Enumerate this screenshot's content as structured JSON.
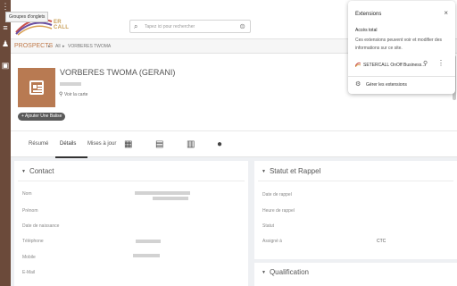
{
  "tooltip": "Groupes d'onglets",
  "header": {
    "logo_text": [
      "ER",
      "CALL"
    ],
    "search_placeholder": "Tapez ici pour rechercher"
  },
  "breadcrumb": {
    "main": "PROSPECTS",
    "items": [
      "All",
      "VORBERES TWOMA"
    ]
  },
  "profile": {
    "name": "VORBERES TWOMA (GERANI)",
    "location_link": "Voir la carte",
    "add_tag_label": "+ Ajouter Une Balise"
  },
  "tabs": {
    "items": [
      "Résumé",
      "Détails",
      "Mises à jour"
    ],
    "active": "Détails"
  },
  "contact": {
    "title": "Contact",
    "fields": [
      "Nom",
      "Prénom",
      "Date de naissance",
      "Téléphone",
      "Mobile",
      "E-Mail"
    ]
  },
  "statut": {
    "title": "Statut et Rappel",
    "fields": [
      "Date de rappel",
      "Heure de rappel",
      "Statut",
      "Assigné à"
    ],
    "assigned_value": "CTC"
  },
  "qualification": {
    "title": "Qualification"
  },
  "extensions": {
    "title": "Extensions",
    "subtitle": "Accès total",
    "description": "Ces extensions peuvent voir et modifier des informations sur ce site.",
    "item_name": "SETERCALL OnOff Business...",
    "manage_label": "Gérer les extensions"
  },
  "colors": {
    "sidebar": "#6b4a3a",
    "accent": "#c07a4a",
    "avatar": "#b87a52"
  }
}
